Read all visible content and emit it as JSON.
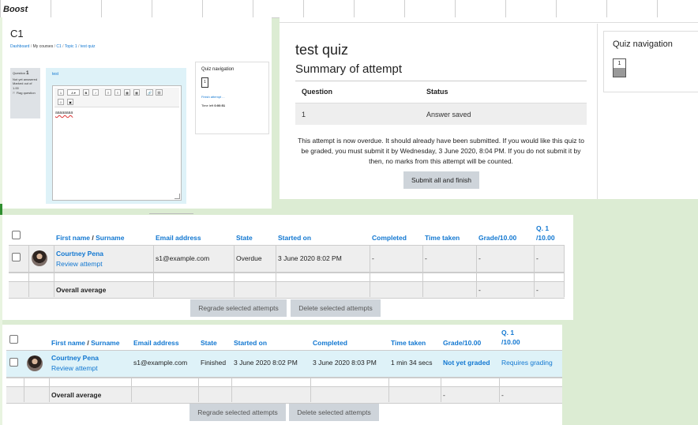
{
  "header": {
    "theme_label": "Boost"
  },
  "quiz_page_small": {
    "course": "C1",
    "breadcrumbs": [
      "Dashboard",
      "My courses",
      "C1",
      "Topic 1",
      "test quiz"
    ],
    "question_info": {
      "question_label": "Question",
      "question_number": "1",
      "status": "Not yet answered",
      "marked": "Marked out of 1.00",
      "flag": "Flag question"
    },
    "question_text": "test",
    "editor_toolbar": [
      "1",
      "A ▾",
      "B",
      "I",
      "≡",
      "≡",
      "▦",
      "▦",
      "🔗",
      "⛓",
      "☺",
      "▣"
    ],
    "answer_text": "aaaaaaaa",
    "nav": {
      "title": "Quiz navigation",
      "button": "1",
      "finish": "Finish attempt ...",
      "time_left_label": "Time left",
      "time_left_value": "0:00:51"
    }
  },
  "summary": {
    "quiz_title": "test quiz",
    "subtitle": "Summary of attempt",
    "col_question": "Question",
    "col_status": "Status",
    "row_question": "1",
    "row_status": "Answer saved",
    "message": "This attempt is now overdue. It should already have been submitted. If you would like this quiz to be graded, you must submit it by Wednesday, 3 June 2020, 8:04 PM. If you do not submit it by then, no marks from this attempt will be counted.",
    "submit_button": "Submit all and finish",
    "nav_title": "Quiz navigation",
    "nav_button": "1"
  },
  "tables": [
    {
      "headers": {
        "first_name": "First name",
        "slash": " / ",
        "surname": "Surname",
        "email": "Email address",
        "state": "State",
        "started": "Started on",
        "completed": "Completed",
        "time_taken": "Time taken",
        "grade": "Grade/10.00",
        "q1_line1": "Q. 1",
        "q1_line2": "/10.00"
      },
      "row": {
        "name": "Courtney Pena",
        "review": "Review attempt",
        "email": "s1@example.com",
        "state": "Overdue",
        "started": "3 June 2020 8:02 PM",
        "completed": "-",
        "time_taken": "-",
        "grade": "-",
        "q1": "-"
      },
      "overall": {
        "label": "Overall average",
        "grade": "-",
        "q1": "-"
      },
      "buttons": {
        "regrade": "Regrade selected attempts",
        "delete": "Delete selected attempts"
      }
    },
    {
      "headers": {
        "first_name": "First name",
        "slash": " / ",
        "surname": "Surname",
        "email": "Email address",
        "state": "State",
        "started": "Started on",
        "completed": "Completed",
        "time_taken": "Time taken",
        "grade": "Grade/10.00",
        "q1_line1": "Q. 1",
        "q1_line2": "/10.00"
      },
      "row": {
        "name": "Courtney Pena",
        "review": "Review attempt",
        "email": "s1@example.com",
        "state": "Finished",
        "started": "3 June 2020 8:02 PM",
        "completed": "3 June 2020 8:03 PM",
        "time_taken": "1 min 34 secs",
        "grade": "Not yet graded",
        "q1": "Requires grading"
      },
      "overall": {
        "label": "Overall average",
        "grade": "-",
        "q1": "-"
      },
      "buttons": {
        "regrade": "Regrade selected attempts",
        "delete": "Delete selected attempts"
      }
    }
  ],
  "colors": {
    "link": "#1177d1",
    "page_bg": "#dcecd3",
    "row_highlight": "#def2f8",
    "button_grey": "#ced4da"
  }
}
